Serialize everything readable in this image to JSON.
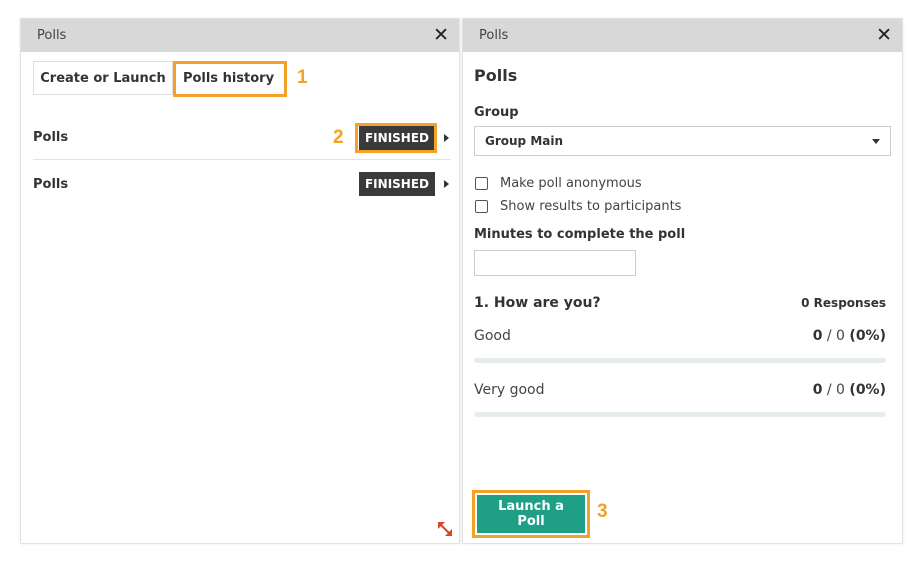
{
  "left_panel": {
    "title": "Polls",
    "tabs": [
      {
        "label": "Create or Launch"
      },
      {
        "label": "Polls history"
      }
    ],
    "polls": [
      {
        "name": "Polls",
        "status": "FINISHED"
      },
      {
        "name": "Polls",
        "status": "FINISHED"
      }
    ]
  },
  "right_panel": {
    "title": "Polls",
    "heading": "Polls",
    "group_label": "Group",
    "group_value": "Group Main",
    "anonymous_label": "Make poll anonymous",
    "show_results_label": "Show results to participants",
    "minutes_label": "Minutes to complete the poll",
    "minutes_value": "",
    "question": "1. How are you?",
    "responses": "0 Responses",
    "options": [
      {
        "label": "Good",
        "count": "0",
        "total": " / 0 ",
        "pct": "(0%)",
        "fraction": 0
      },
      {
        "label": "Very good",
        "count": "0",
        "total": " / 0 ",
        "pct": "(0%)",
        "fraction": 0
      }
    ],
    "launch_label": "Launch a Poll"
  },
  "annotations": {
    "step1": "1",
    "step2": "2",
    "step3": "3"
  },
  "colors": {
    "highlight": "#f4a127",
    "accent": "#1e9f86",
    "badge": "#3a3a3a",
    "header": "#d8d8d8"
  },
  "icons": {
    "close": "close-icon",
    "caret": "caret-right-icon",
    "dropdown": "chevron-down-icon",
    "resize": "resize-icon"
  }
}
